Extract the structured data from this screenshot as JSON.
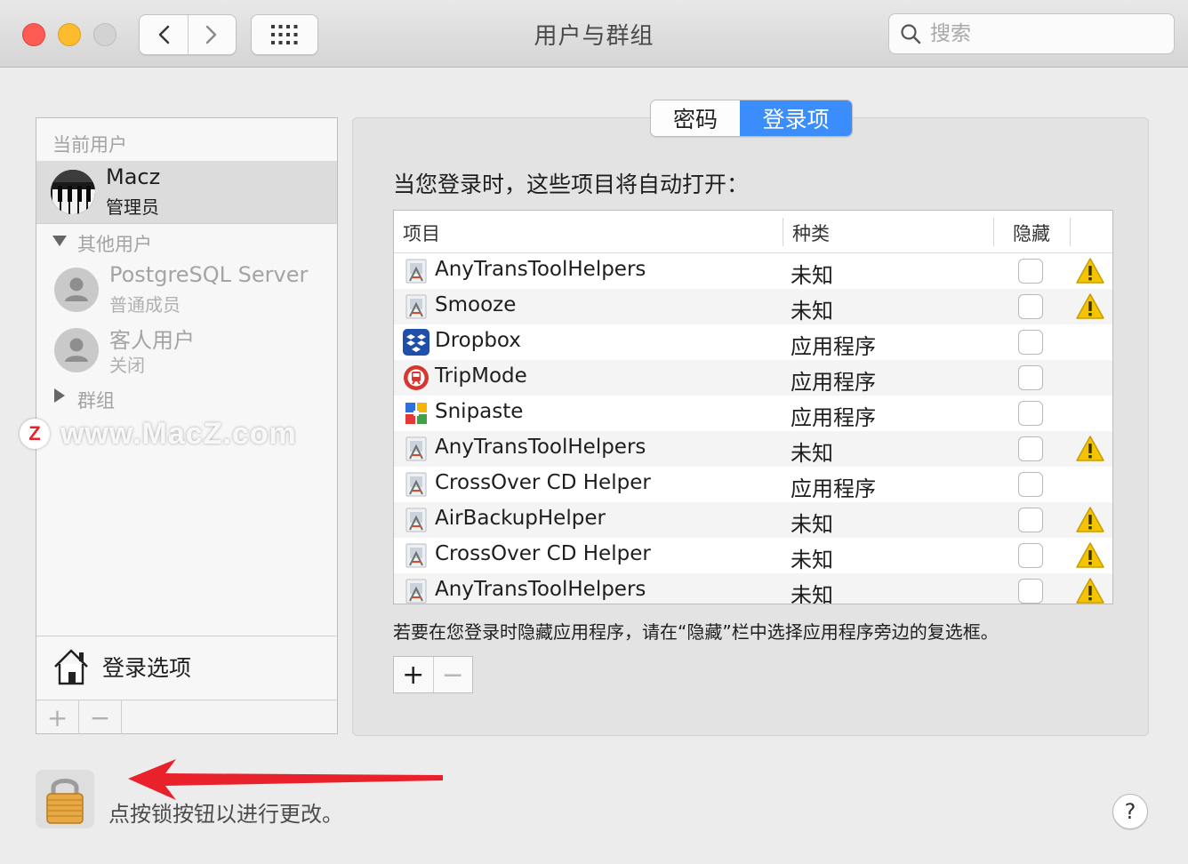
{
  "window": {
    "title": "用户与群组",
    "search_placeholder": "搜索"
  },
  "toolbar": {
    "back_icon": "chevron-left-icon",
    "forward_icon": "chevron-right-icon",
    "grid_icon": "show-all-grid-icon"
  },
  "sidebar": {
    "current_header": "当前用户",
    "current_user": {
      "name": "Macz",
      "role": "管理员"
    },
    "others_header": "其他用户",
    "other_users": [
      {
        "name": "PostgreSQL Server",
        "role": "普通成员"
      },
      {
        "name": "客人用户",
        "role": "关闭"
      }
    ],
    "groups_header": "群组",
    "login_options": "登录选项",
    "add_label": "+",
    "remove_label": "−"
  },
  "tabs": [
    {
      "label": "密码",
      "active": false
    },
    {
      "label": "登录项",
      "active": true
    }
  ],
  "panel": {
    "caption": "当您登录时，这些项目将自动打开：",
    "columns": {
      "item": "项目",
      "kind": "种类",
      "hide": "隐藏"
    },
    "rows": [
      {
        "name": "AnyTransToolHelpers",
        "kind": "未知",
        "icon": "generic-app-icon",
        "warning": true
      },
      {
        "name": "Smooze",
        "kind": "未知",
        "icon": "generic-app-icon",
        "warning": true
      },
      {
        "name": "Dropbox",
        "kind": "应用程序",
        "icon": "dropbox-icon",
        "warning": false
      },
      {
        "name": "TripMode",
        "kind": "应用程序",
        "icon": "tripmode-icon",
        "warning": false
      },
      {
        "name": "Snipaste",
        "kind": "应用程序",
        "icon": "snipaste-icon",
        "warning": false
      },
      {
        "name": "AnyTransToolHelpers",
        "kind": "未知",
        "icon": "generic-app-icon",
        "warning": true
      },
      {
        "name": "CrossOver CD Helper",
        "kind": "应用程序",
        "icon": "generic-app-icon",
        "warning": false
      },
      {
        "name": "AirBackupHelper",
        "kind": "未知",
        "icon": "generic-app-icon",
        "warning": true
      },
      {
        "name": "CrossOver CD Helper",
        "kind": "未知",
        "icon": "generic-app-icon",
        "warning": true
      },
      {
        "name": "AnyTransToolHelpers",
        "kind": "未知",
        "icon": "generic-app-icon",
        "warning": true
      }
    ],
    "hint": "若要在您登录时隐藏应用程序，请在“隐藏”栏中选择应用程序旁边的复选框。",
    "add_label": "+",
    "remove_label": "−"
  },
  "footer": {
    "lock_text": "点按锁按钮以进行更改。",
    "help_label": "?"
  },
  "watermark": {
    "text": "www.MacZ.com",
    "badge": "Z"
  },
  "colors": {
    "accent": "#3b8dfb",
    "warning": "#f5c400",
    "annotation_arrow": "#e8212b"
  }
}
